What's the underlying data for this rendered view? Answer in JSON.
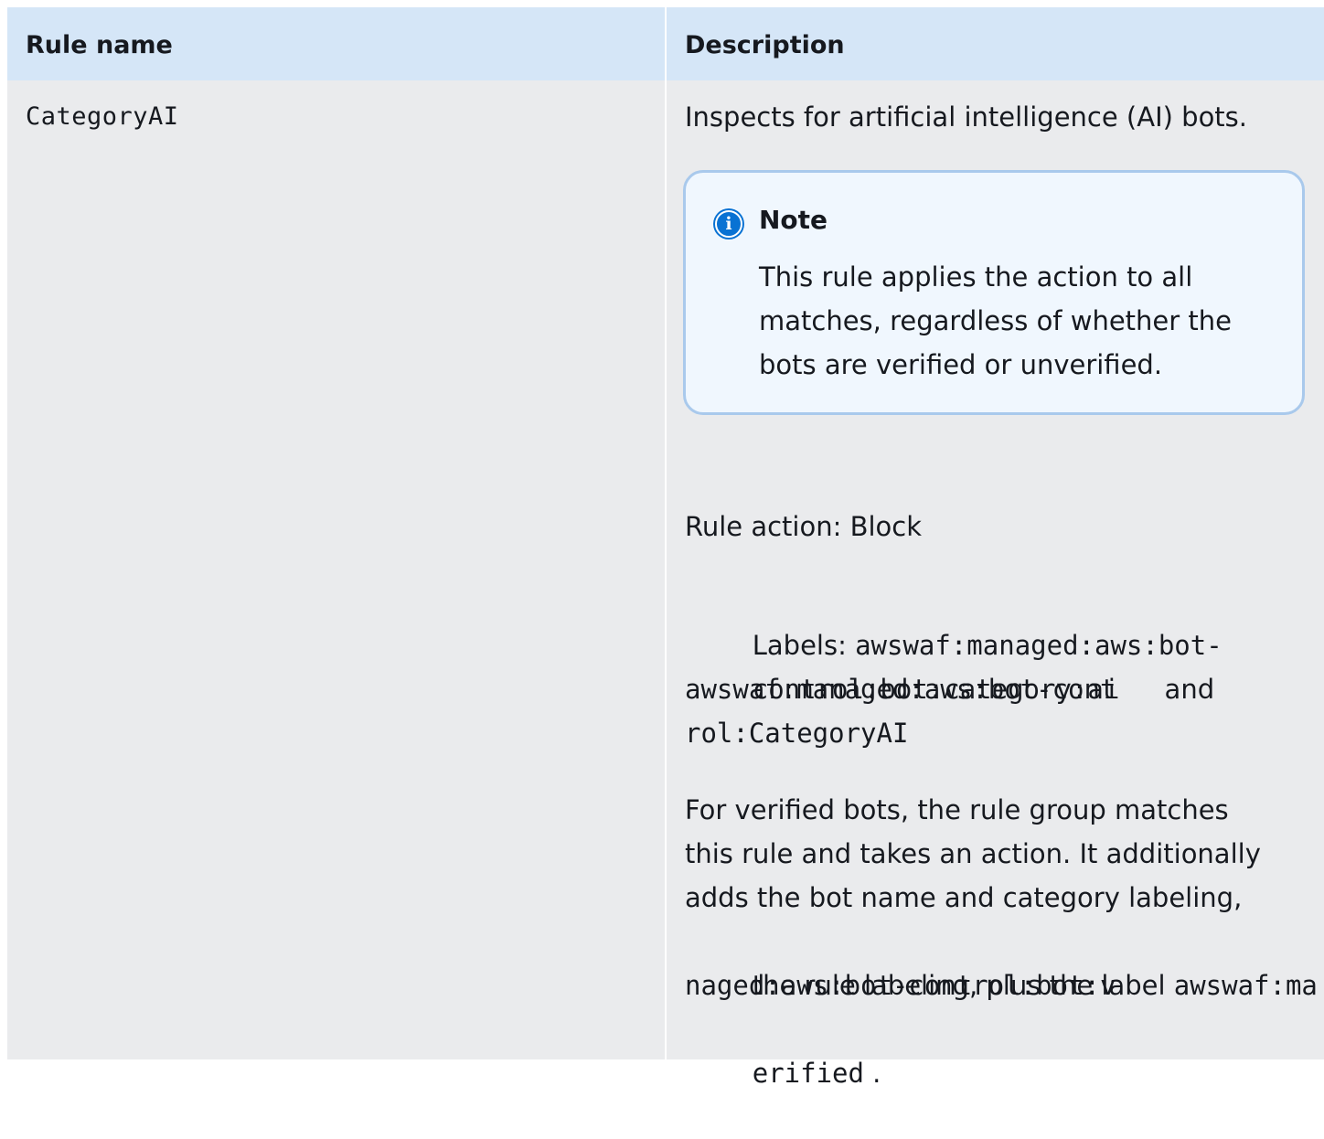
{
  "table": {
    "headers": [
      "Rule name",
      "Description"
    ],
    "row": {
      "rule_name": "CategoryAI",
      "description_intro": "Inspects for artificial intelligence (AI) bots.",
      "note": {
        "icon": "info-icon",
        "title": "Note",
        "body_lines": [
          "This rule applies the action to all",
          "matches, regardless of whether the",
          "bots are verified or unverified."
        ]
      },
      "rule_action": "Rule action: Block",
      "labels": {
        "prefix": "Labels: ",
        "label1_part1": "awswaf:managed:aws:bot-",
        "label1_part2": "control:bot:category:ai",
        "joiner": " and",
        "label2_part1": "awswaf:managed:aws:bot-cont",
        "label2_part2": "rol:CategoryAI"
      },
      "verified": {
        "lines": [
          "For verified bots, the rule group matches",
          "this rule and takes an action. It additionally",
          "adds the bot name and category labeling,"
        ],
        "line4_text": "the rule labeling, plus the label ",
        "label_part1": "awswaf:ma",
        "label_part2": "naged:aws:bot-control:bot:v",
        "label_part3": "erified",
        "end": " ."
      }
    }
  }
}
